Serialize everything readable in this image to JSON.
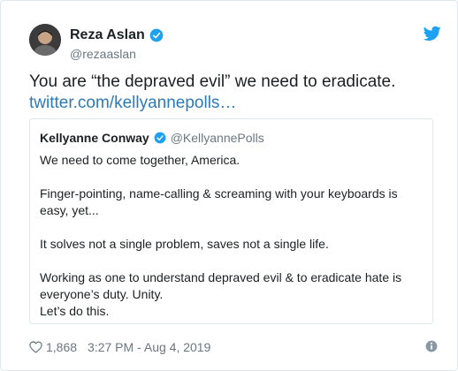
{
  "author": {
    "name": "Reza Aslan",
    "handle": "@rezaaslan",
    "verified_icon": "verified-badge-icon"
  },
  "tweet": {
    "text": "You are “the depraved evil” we need to eradicate.",
    "link": "twitter.com/kellyannepolls…"
  },
  "quoted": {
    "name": "Kellyanne Conway",
    "handle": "@KellyannePolls",
    "paragraphs": [
      "We need to come together, America.",
      "Finger-pointing, name-calling & screaming with your keyboards is easy, yet...",
      "It solves not a single problem, saves not a single life.",
      "Working as one to understand depraved evil & to eradicate hate is everyone’s duty. Unity.\nLet’s do this."
    ]
  },
  "footer": {
    "likes": "1,868",
    "timestamp": "3:27 PM - Aug 4, 2019"
  },
  "colors": {
    "brand": "#1da1f2",
    "link": "#2b7bb9",
    "muted": "#697882",
    "border": "#e1e8ed"
  }
}
